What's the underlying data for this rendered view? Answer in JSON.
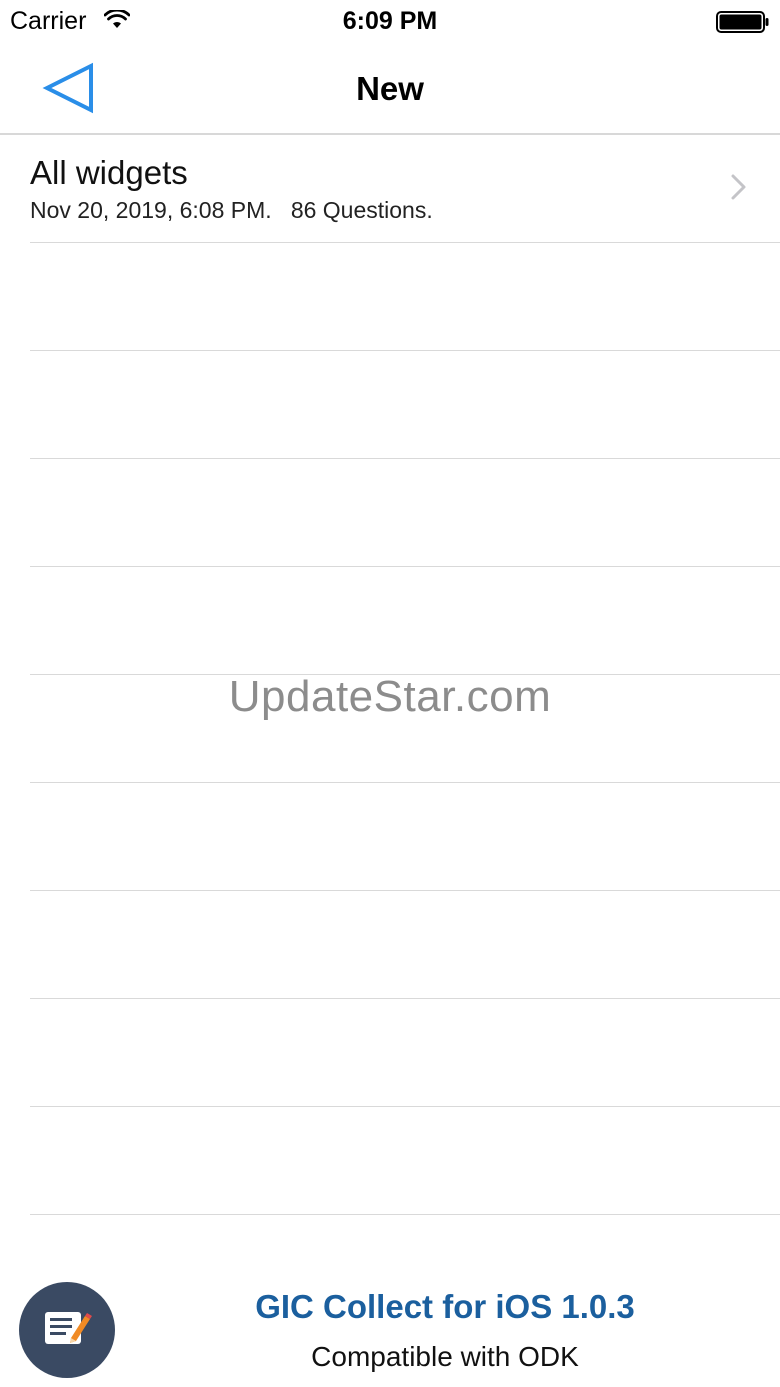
{
  "status_bar": {
    "carrier": "Carrier",
    "time": "6:09 PM",
    "wifi_icon": "wifi-icon",
    "battery_icon": "battery-icon"
  },
  "nav": {
    "title": "New",
    "back_icon": "back-triangle-icon",
    "accent_color": "#2a8ee8"
  },
  "forms": [
    {
      "title": "All widgets",
      "subtitle": "Nov 20, 2019, 6:08 PM.   86 Questions.",
      "chevron_icon": "chevron-right-icon"
    }
  ],
  "watermark": "UpdateStar.com",
  "footer": {
    "fab_icon": "edit-form-icon",
    "fab_color": "#3a4a63",
    "title": "GIC Collect for iOS 1.0.3",
    "title_color": "#1b5f9e",
    "subtitle": "Compatible with ODK"
  }
}
